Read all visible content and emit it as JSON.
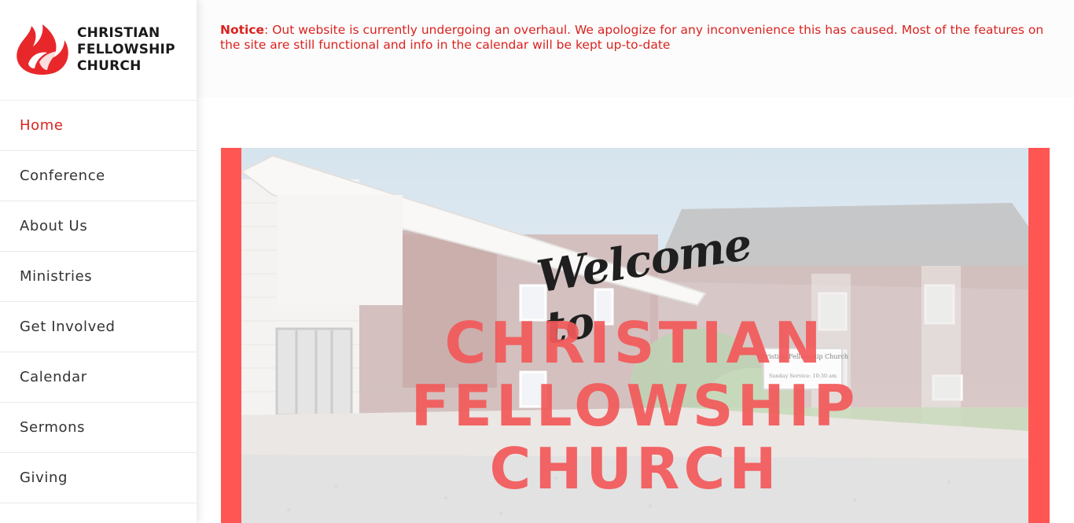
{
  "brand": {
    "name_lines": [
      "CHRISTIAN",
      "FELLOWSHIP",
      "CHURCH"
    ],
    "accent_color": "#d9231f",
    "logo_icon": "flame-icon"
  },
  "nav": {
    "items": [
      {
        "label": "Home",
        "active": true
      },
      {
        "label": "Conference"
      },
      {
        "label": "About Us"
      },
      {
        "label": "Ministries"
      },
      {
        "label": "Get Involved"
      },
      {
        "label": "Calendar"
      },
      {
        "label": "Sermons"
      },
      {
        "label": "Giving"
      }
    ]
  },
  "notice": {
    "label": "Notice",
    "text": ": Out website is currently undergoing an overhaul. We apologize for any inconvenience this has caused. Most of the features on the site are still functional and info in the calendar will be kept up-to-date"
  },
  "hero": {
    "welcome": "Welcome to",
    "title_lines": [
      "CHRISTIAN",
      "FELLOWSHIP",
      "CHURCH"
    ],
    "frame_color": "#ff5654",
    "sign": {
      "title": "Christian Fellowship Church",
      "service": "Sunday Service: 10:30 am"
    }
  }
}
